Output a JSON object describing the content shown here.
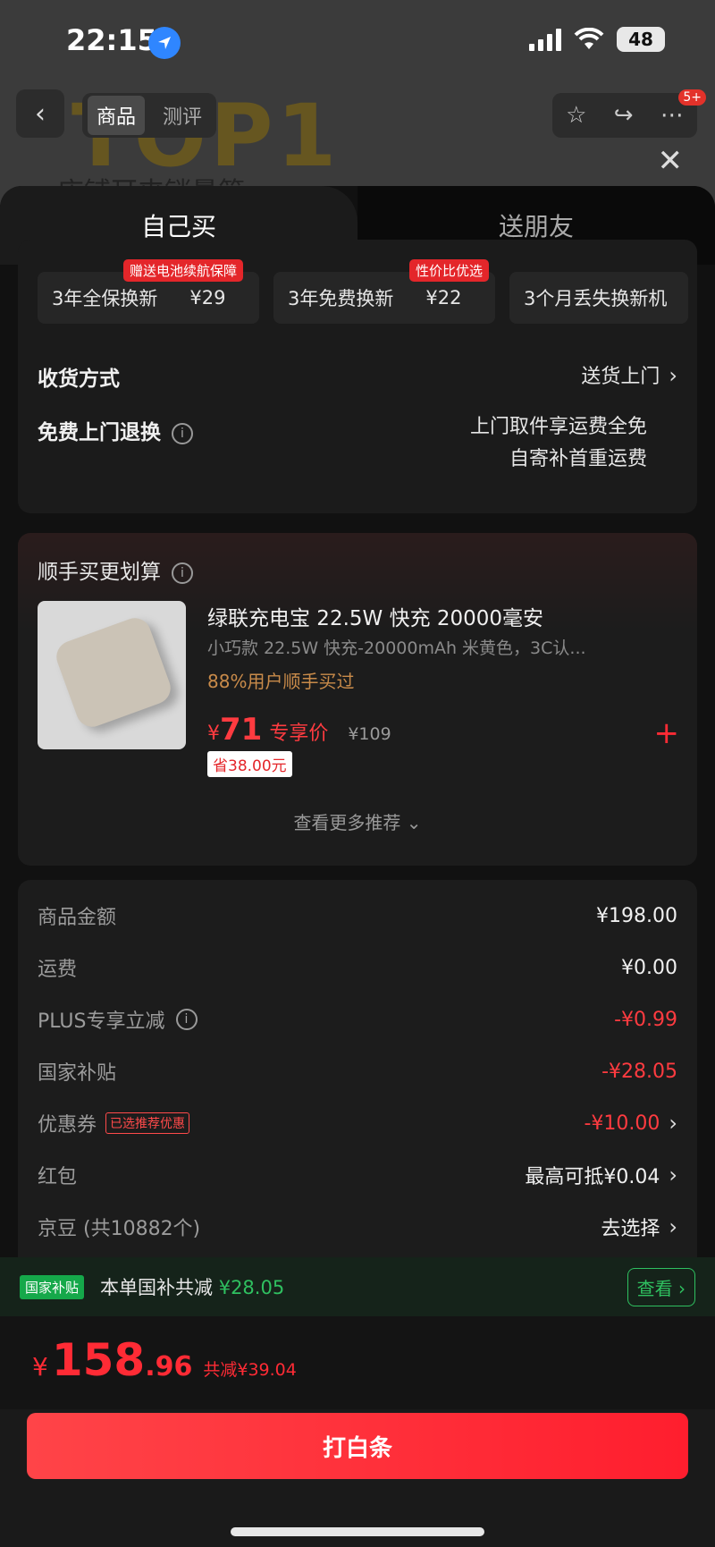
{
  "status": {
    "time": "22:15",
    "battery": "48"
  },
  "nav": {
    "tabs": [
      "商品",
      "测评"
    ],
    "badge": "5+"
  },
  "background": {
    "headline": "TOP1",
    "subline": "店铺耳夹销量第"
  },
  "segment": {
    "buy_self": "自己买",
    "gift": "送朋友"
  },
  "services": [
    {
      "name": "3年全保换新",
      "price": "¥29",
      "tag": "赠送电池续航保障"
    },
    {
      "name": "3年免费换新",
      "price": "¥22",
      "tag": "性价比优选"
    },
    {
      "name": "3个月丢失换新机",
      "price": "",
      "tag": ""
    }
  ],
  "delivery": {
    "label": "收货方式",
    "value": "送货上门"
  },
  "returns": {
    "label": "免费上门退换",
    "line1": "上门取件享运费全免",
    "line2": "自寄补首重运费"
  },
  "addon": {
    "title": "顺手买更划算",
    "name": "绿联充电宝 22.5W 快充 20000毫安",
    "spec": "小巧款 22.5W 快充-20000mAh 米黄色，3C认...",
    "bought": "88%用户顺手买过",
    "price_symbol": "¥",
    "price": "71",
    "price_label": "专享价",
    "original": "¥109",
    "save": "省38.00元",
    "more": "查看更多推荐"
  },
  "summary": {
    "rows": [
      {
        "label": "商品金额",
        "value": "¥198.00"
      },
      {
        "label": "运费",
        "value": "¥0.00"
      },
      {
        "label": "PLUS专享立减",
        "value": "-¥0.99"
      },
      {
        "label": "国家补贴",
        "value": "-¥28.05"
      },
      {
        "label": "优惠券",
        "value": "-¥10.00",
        "tag": "已选推荐优惠"
      },
      {
        "label": "红包",
        "value": "最高可抵¥0.04"
      },
      {
        "label": "京豆 (共10882个)",
        "value": "去选择"
      }
    ]
  },
  "subsidy": {
    "tag": "国家补贴",
    "text": "本单国补共减",
    "amount": "¥28.05",
    "button": "查看"
  },
  "total": {
    "yen": "¥",
    "int": "158",
    "dec": ".96",
    "discount": "共减¥39.04"
  },
  "pay": {
    "label": "打白条"
  },
  "colors": {
    "accent_red": "#ff2b35",
    "subsidy_green": "#2fc060",
    "sheet_bg": "#111111"
  }
}
